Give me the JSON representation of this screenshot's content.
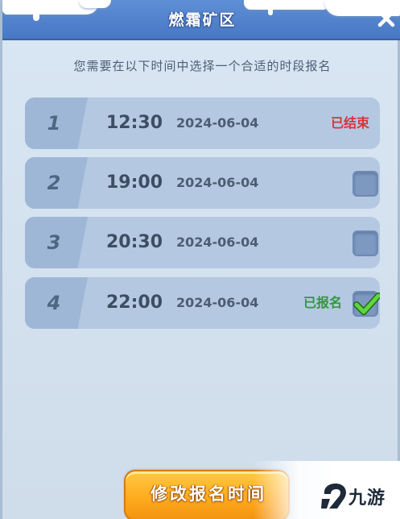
{
  "dialog": {
    "title": "燃霜矿区",
    "subtitle": "您需要在以下时间中选择一个合适的时段报名",
    "close_icon": "close-icon"
  },
  "slots": [
    {
      "index": "1",
      "time": "12:30",
      "date": "2024-06-04",
      "status": "已结束",
      "state": "ended"
    },
    {
      "index": "2",
      "time": "19:00",
      "date": "2024-06-04",
      "status": "",
      "state": "available",
      "checked": false
    },
    {
      "index": "3",
      "time": "20:30",
      "date": "2024-06-04",
      "status": "",
      "state": "available",
      "checked": false
    },
    {
      "index": "4",
      "time": "22:00",
      "date": "2024-06-04",
      "status": "已报名",
      "state": "registered",
      "checked": true
    }
  ],
  "footer": {
    "modify_button_label": "修改报名时间"
  },
  "watermark": {
    "text": "九游",
    "logo_icon": "jiuyou-logo-icon"
  },
  "colors": {
    "header": "#4f80cc",
    "ended": "#d8333c",
    "registered": "#2e9a3a",
    "button": "#ffab1f"
  }
}
